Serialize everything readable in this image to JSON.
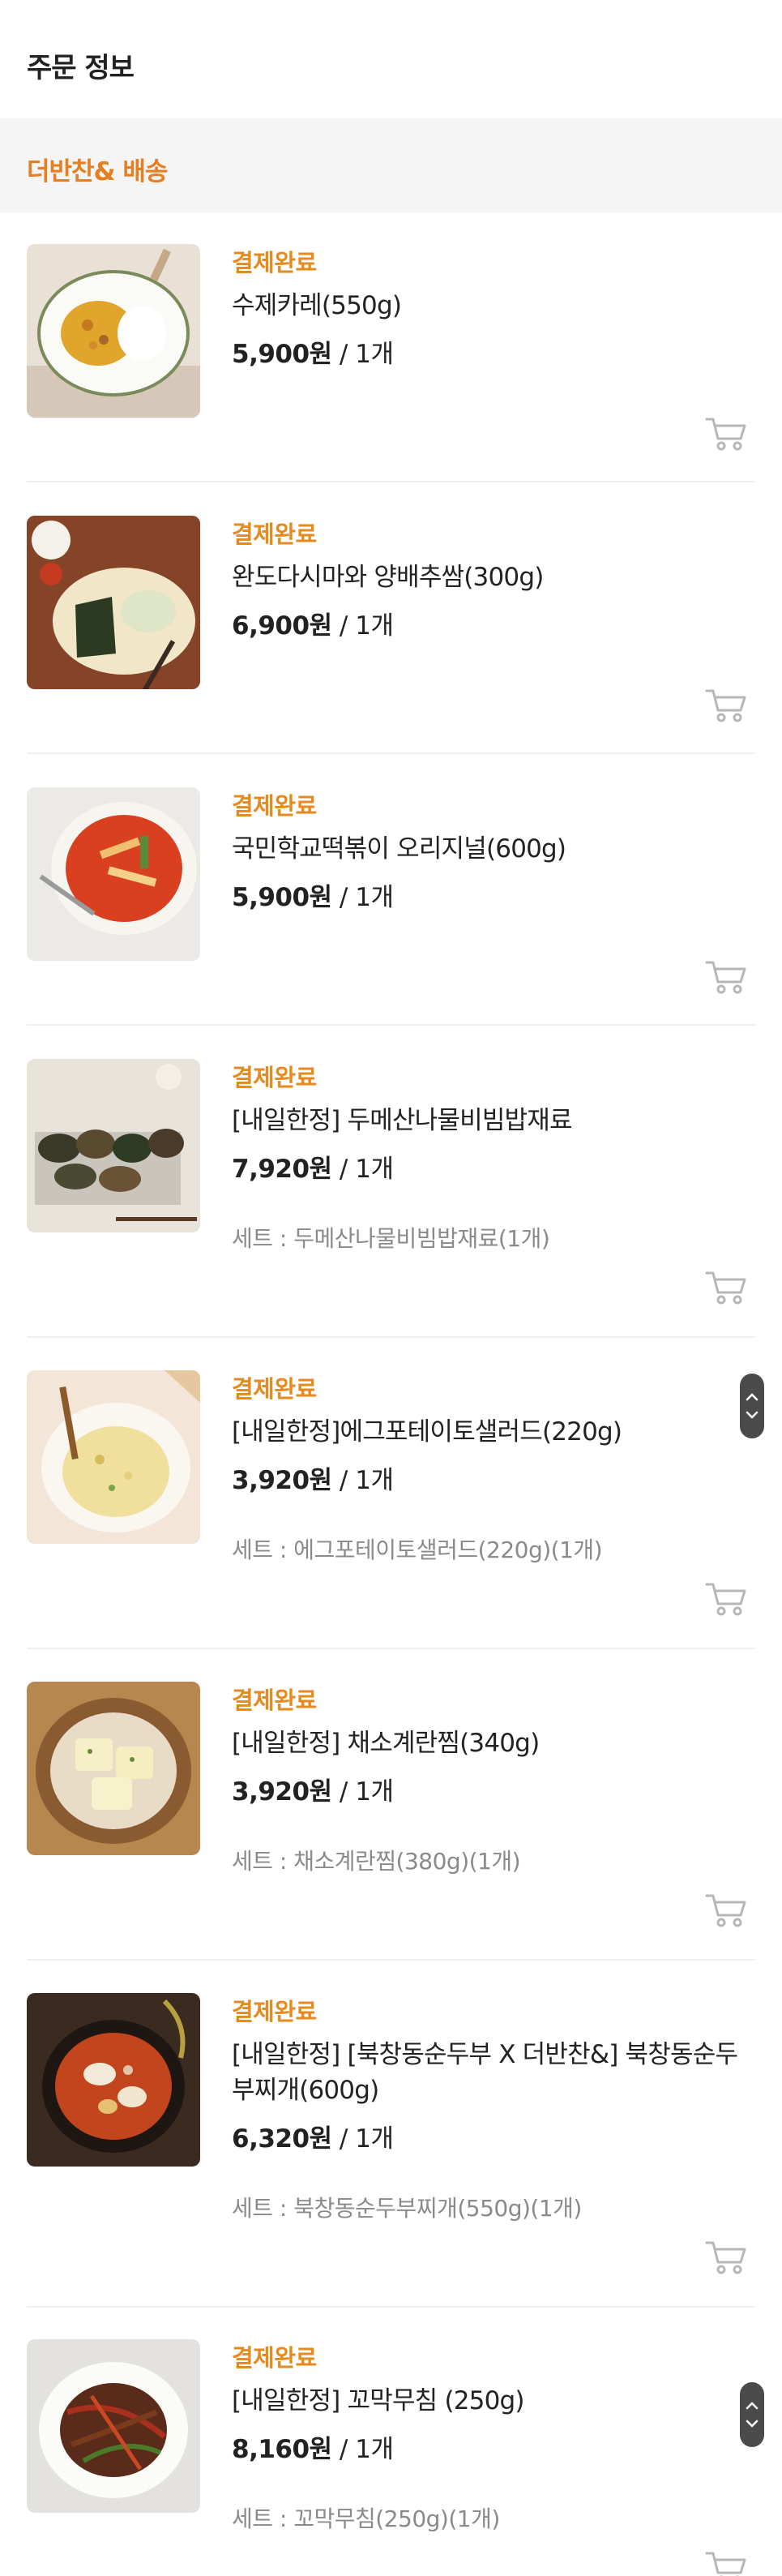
{
  "header": {
    "title": "주문 정보"
  },
  "section": {
    "title": "더반찬& 배송"
  },
  "items": [
    {
      "status": "결제완료",
      "name": "수제카레(550g)",
      "price": "5,900원",
      "qty": " / 1개",
      "set": ""
    },
    {
      "status": "결제완료",
      "name": "완도다시마와 양배추쌈(300g)",
      "price": "6,900원",
      "qty": " / 1개",
      "set": ""
    },
    {
      "status": "결제완료",
      "name": "국민학교떡볶이 오리지널(600g)",
      "price": "5,900원",
      "qty": " / 1개",
      "set": ""
    },
    {
      "status": "결제완료",
      "name": "[내일한정] 두메산나물비빔밥재료",
      "price": "7,920원",
      "qty": " / 1개",
      "set": "세트 : 두메산나물비빔밥재료(1개)"
    },
    {
      "status": "결제완료",
      "name": "[내일한정]에그포테이토샐러드(220g)",
      "price": "3,920원",
      "qty": " / 1개",
      "set": "세트 : 에그포테이토샐러드(220g)(1개)"
    },
    {
      "status": "결제완료",
      "name": "[내일한정] 채소계란찜(340g)",
      "price": "3,920원",
      "qty": " / 1개",
      "set": "세트 : 채소계란찜(380g)(1개)"
    },
    {
      "status": "결제완료",
      "name": "[내일한정] [북창동순두부 X 더반찬&] 북창동순두부찌개(600g)",
      "price": "6,320원",
      "qty": " / 1개",
      "set": "세트 : 북창동순두부찌개(550g)(1개)"
    },
    {
      "status": "결제완료",
      "name": "[내일한정] 꼬막무침 (250g)",
      "price": "8,160원",
      "qty": " / 1개",
      "set": "세트 : 꼬막무침(250g)(1개)"
    }
  ],
  "icons": {
    "cart": "cart-icon",
    "scroll": "scroll-handle-icon"
  },
  "colors": {
    "status": "#e58a1f",
    "section_title": "#e67e22",
    "section_bg": "#f5f5f5"
  }
}
